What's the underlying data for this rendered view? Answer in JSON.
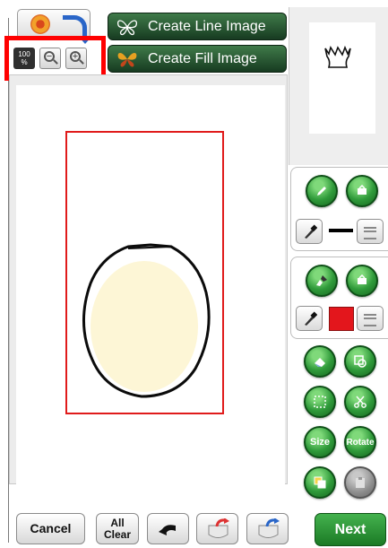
{
  "toolbar": {
    "import_image_icon": "flower-with-arrow-icon",
    "zoom_level": "100\n%",
    "zoom_out_icon": "zoom-out-icon",
    "zoom_in_icon": "zoom-in-icon"
  },
  "create": {
    "line_label": "Create Line Image",
    "fill_label": "Create Fill Image"
  },
  "tools": {
    "line_group": [
      "pencil-icon",
      "line-properties-icon",
      "eyedropper-icon",
      "line-style-icon"
    ],
    "line_color": "#000000",
    "fill_group": [
      "paint-brush-icon",
      "fill-properties-icon",
      "eyedropper-icon",
      "fill-style-icon"
    ],
    "fill_color": "#e3161c",
    "size_label": "Size",
    "rotate_label": "Rotate"
  },
  "bottom": {
    "cancel_label": "Cancel",
    "all_clear_line1": "All",
    "all_clear_line2": "Clear",
    "next_label": "Next"
  },
  "colors": {
    "accent_green": "#2f9a3a",
    "highlight_red": "#ff0000"
  }
}
